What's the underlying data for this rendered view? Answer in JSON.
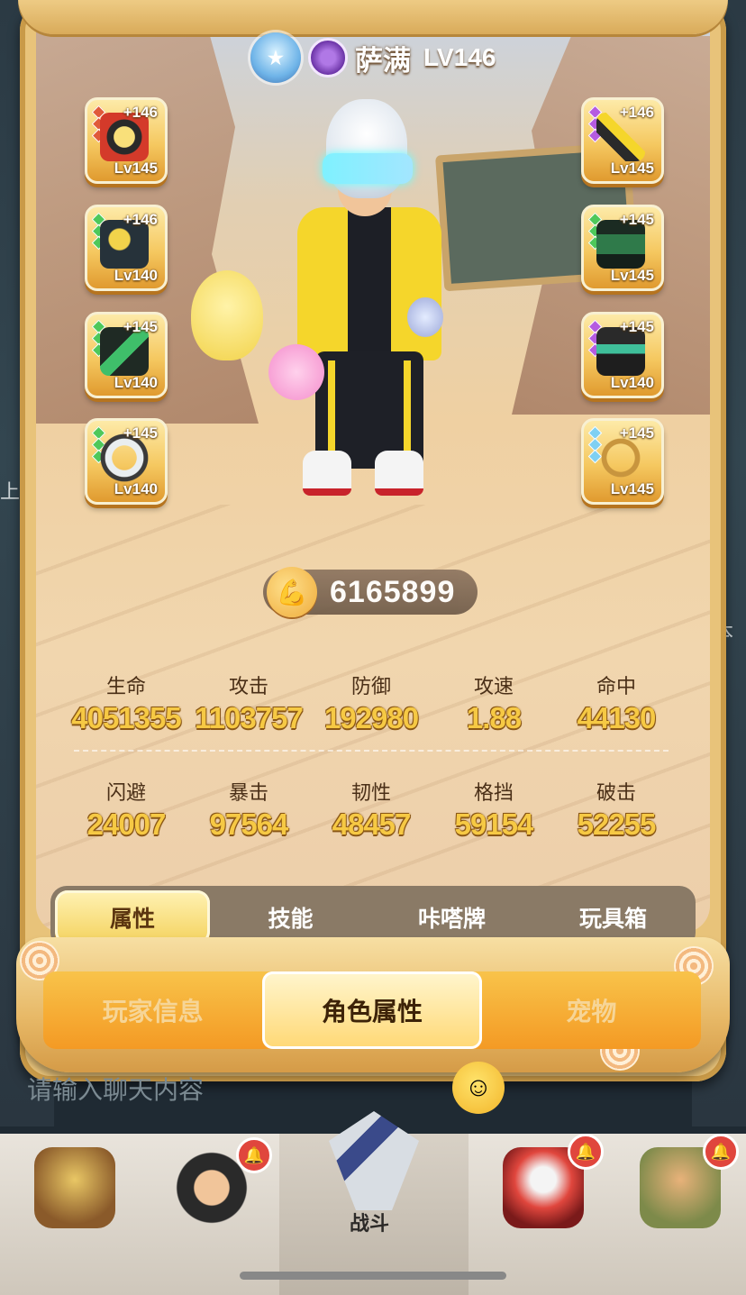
{
  "header": {
    "player_name": "萨满",
    "player_level": "LV146",
    "rank_icon": "rank-badge-icon",
    "emblem_icon": "purple-emblem-icon"
  },
  "equipment": {
    "left": [
      {
        "plus": "+146",
        "level": "Lv145",
        "icon": "target-disc-icon",
        "gems": [
          "#e05a3a",
          "#e05a3a",
          "#e05a3a"
        ]
      },
      {
        "plus": "+146",
        "level": "Lv140",
        "icon": "pet-bird-icon",
        "gems": [
          "#4ec85a",
          "#4ec85a",
          "#4ec85a"
        ]
      },
      {
        "plus": "+145",
        "level": "Lv140",
        "icon": "glove-icon",
        "gems": [
          "#4ec85a",
          "#4ec85a",
          "#4ec85a"
        ]
      },
      {
        "plus": "+145",
        "level": "Lv140",
        "icon": "ring-icon",
        "gems": [
          "#4ec85a",
          "#4ec85a",
          "#4ec85a"
        ]
      }
    ],
    "right": [
      {
        "plus": "+146",
        "level": "Lv145",
        "icon": "blade-icon",
        "gems": [
          "#b55be0",
          "#b55be0",
          "#b55be0"
        ]
      },
      {
        "plus": "+145",
        "level": "Lv145",
        "icon": "cape-icon",
        "gems": [
          "#4ec85a",
          "#4ec85a",
          "#4ec85a"
        ]
      },
      {
        "plus": "+145",
        "level": "Lv140",
        "icon": "armor-icon",
        "gems": [
          "#b55be0",
          "#b55be0",
          "#b55be0"
        ]
      },
      {
        "plus": "+145",
        "level": "Lv145",
        "icon": "necklace-icon",
        "gems": [
          "#7fd0f2",
          "#7fd0f2",
          "#7fd0f2"
        ]
      }
    ]
  },
  "power": {
    "value": "6165899",
    "icon": "flexed-arm-icon"
  },
  "stats": {
    "row1": [
      {
        "label": "生命",
        "value": "4051355"
      },
      {
        "label": "攻击",
        "value": "1103757"
      },
      {
        "label": "防御",
        "value": "192980"
      },
      {
        "label": "攻速",
        "value": "1.88"
      },
      {
        "label": "命中",
        "value": "44130"
      }
    ],
    "row2": [
      {
        "label": "闪避",
        "value": "24007"
      },
      {
        "label": "暴击",
        "value": "97564"
      },
      {
        "label": "韧性",
        "value": "48457"
      },
      {
        "label": "格挡",
        "value": "59154"
      },
      {
        "label": "破击",
        "value": "52255"
      }
    ]
  },
  "subtabs": [
    "属性",
    "技能",
    "咔嗒牌",
    "玩具箱"
  ],
  "main_tabs": [
    "玩家信息",
    "角色属性",
    "宠物"
  ],
  "chat": {
    "placeholder": "请输入聊天内容"
  },
  "footer": {
    "battle_label": "战斗"
  },
  "background_side": {
    "left_text": "上拨",
    "right_text": "本"
  }
}
